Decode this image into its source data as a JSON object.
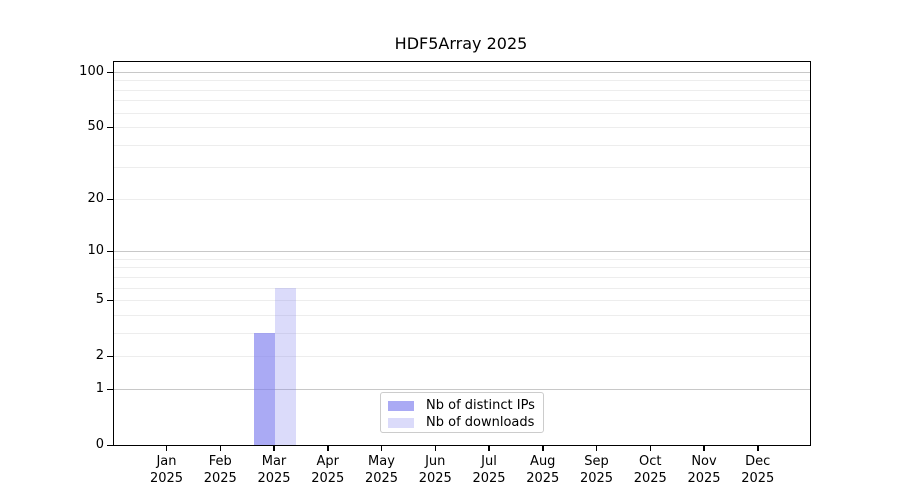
{
  "chart_data": {
    "type": "bar",
    "title": "HDF5Array 2025",
    "months": [
      "Jan",
      "Feb",
      "Mar",
      "Apr",
      "May",
      "Jun",
      "Jul",
      "Aug",
      "Sep",
      "Oct",
      "Nov",
      "Dec"
    ],
    "year": "2025",
    "categories": [
      "Jan 2025",
      "Feb 2025",
      "Mar 2025",
      "Apr 2025",
      "May 2025",
      "Jun 2025",
      "Jul 2025",
      "Aug 2025",
      "Sep 2025",
      "Oct 2025",
      "Nov 2025",
      "Dec 2025"
    ],
    "series": [
      {
        "name": "Nb of distinct IPs",
        "color": "rgba(125,125,238,0.65)",
        "color_hex_on_white": "#adadf4",
        "values": [
          0,
          0,
          3,
          0,
          0,
          0,
          0,
          0,
          0,
          0,
          0,
          0
        ]
      },
      {
        "name": "Nb of downloads",
        "color": "rgba(125,125,238,0.28)",
        "color_hex_on_white": "#dbdbfa",
        "values": [
          0,
          0,
          6,
          0,
          0,
          0,
          0,
          0,
          0,
          0,
          0,
          0
        ]
      }
    ],
    "xlabel": "",
    "ylabel": "",
    "y_axis": {
      "ticks": [
        0,
        1,
        2,
        5,
        10,
        20,
        50,
        100
      ],
      "scale": "log1p",
      "ylim": [
        0,
        112
      ]
    },
    "gridlines": {
      "major": [
        1,
        10,
        100
      ],
      "minor": [
        2,
        3,
        4,
        5,
        6,
        7,
        8,
        9,
        20,
        30,
        40,
        50,
        60,
        70,
        80,
        90
      ]
    },
    "legend": {
      "position": "inside-bottom-center",
      "items": [
        "Nb of distinct IPs",
        "Nb of downloads"
      ]
    },
    "grid": true
  }
}
